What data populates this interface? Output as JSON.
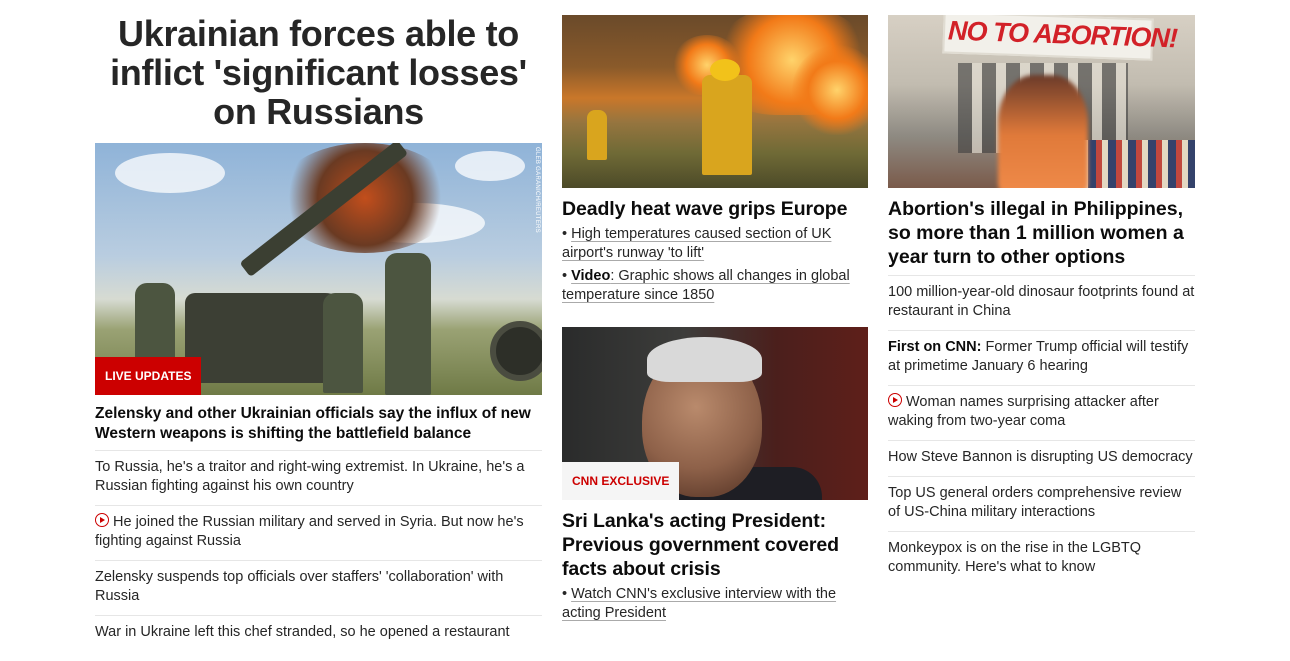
{
  "left": {
    "lead_headline": "Ukrainian forces able to inflict 'significant losses' on Russians",
    "image_badge": "LIVE UPDATES",
    "image_credit": "GLEB GARANICH/REUTERS",
    "sub_headline": "Zelensky and other Ukrainian officials say the influx of new Western weapons is shifting the battlefield balance",
    "items": [
      {
        "text": "To Russia, he's a traitor and right-wing extremist. In Ukraine, he's a Russian fighting against his own country"
      },
      {
        "text": "He joined the Russian military and served in Syria. But now he's fighting against Russia",
        "icon": "play-icon"
      },
      {
        "text": "Zelensky suspends top officials over staffers' 'collaboration' with Russia"
      },
      {
        "text": "War in Ukraine left this chef stranded, so he opened a restaurant"
      }
    ]
  },
  "middle": {
    "story1": {
      "headline": "Deadly heat wave grips Europe",
      "bullet1": "High temperatures caused section of UK airport's runway 'to lift'",
      "bullet2_bold": "Video",
      "bullet2": ": Graphic shows all changes in global temperature since 1850"
    },
    "story2": {
      "image_badge": "CNN EXCLUSIVE",
      "headline": "Sri Lanka's acting President: Previous government covered facts about crisis",
      "bullet1": "Watch CNN's exclusive interview with the acting President"
    }
  },
  "right": {
    "banner_text": "NO TO ABORTION!",
    "headline": "Abortion's illegal in Philippines, so more than 1 million women a year turn to other options",
    "items": [
      {
        "text": "100 million-year-old dinosaur footprints found at restaurant in China"
      },
      {
        "bold": "First on CNN:",
        "text": " Former Trump official will testify at primetime January 6 hearing"
      },
      {
        "text": "Woman names surprising attacker after waking from two-year coma",
        "icon": "play-icon"
      },
      {
        "text": "How Steve Bannon is disrupting US democracy"
      },
      {
        "text": "Top US general orders comprehensive review of US-China military interactions"
      },
      {
        "text": "Monkeypox is on the rise in the LGBTQ community. Here's what to know"
      }
    ]
  },
  "colors": {
    "accent_red": "#cc0000",
    "text": "#262626",
    "divider": "#e6e6e6"
  }
}
